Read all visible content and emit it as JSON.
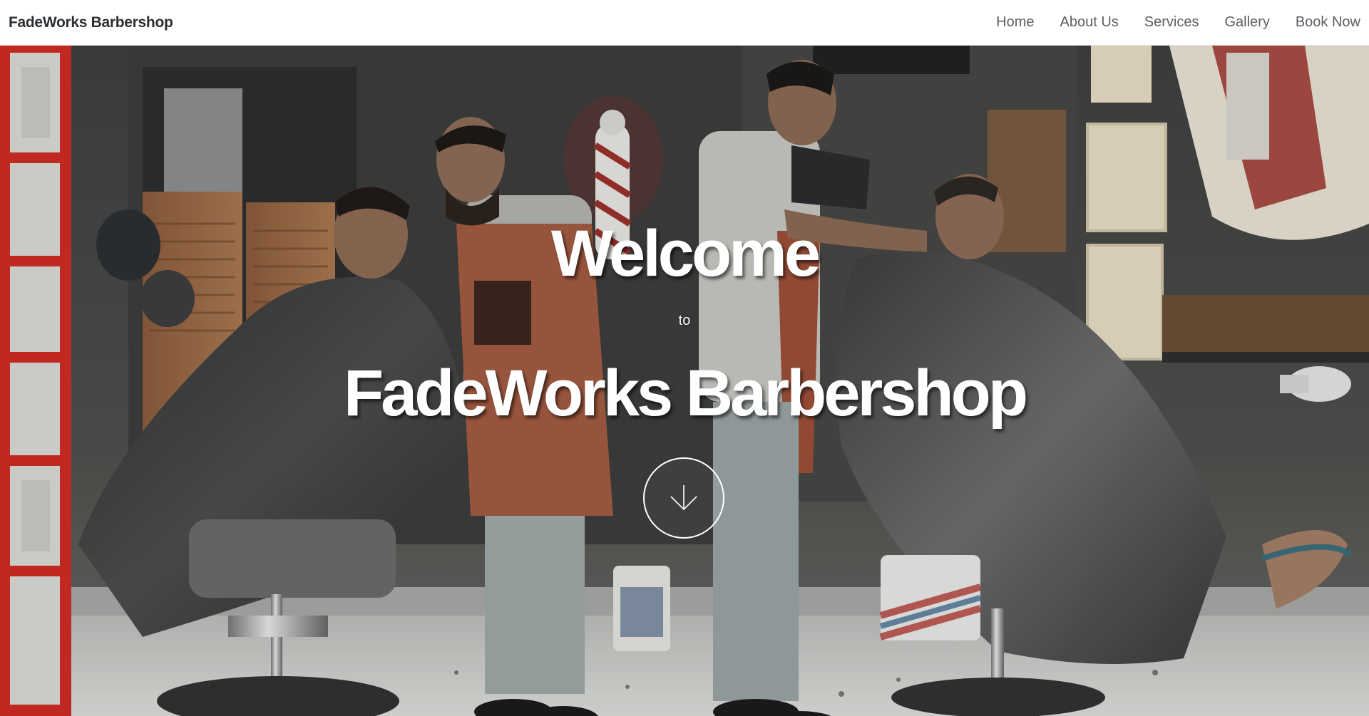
{
  "navbar": {
    "brand": "FadeWorks Barbershop",
    "links": [
      "Home",
      "About Us",
      "Services",
      "Gallery",
      "Book Now"
    ]
  },
  "hero": {
    "welcome": "Welcome",
    "to": "to",
    "name": "FadeWorks Barbershop",
    "scroll_icon": "arrow-down-icon"
  },
  "colors": {
    "brand_text": "#2b2f33",
    "nav_text": "#5b5f63",
    "hero_text": "#ffffff",
    "door_red": "#d0281f"
  }
}
